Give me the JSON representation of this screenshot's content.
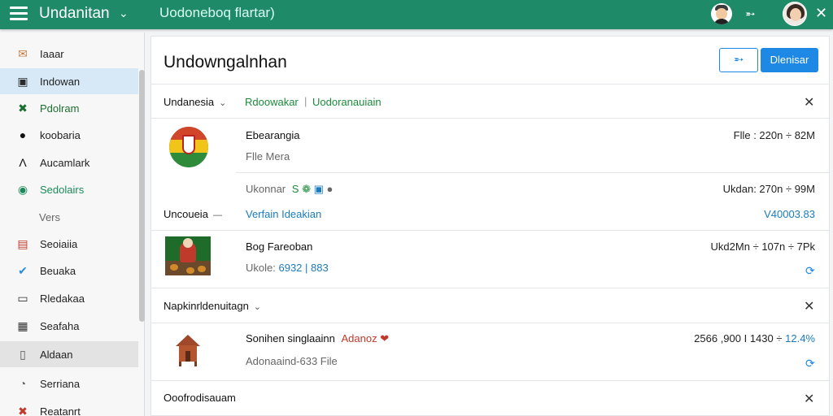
{
  "header": {
    "title": "Undanitan",
    "subtitle": "Uodoneboq flartar)",
    "menu_icon": "hamburger-icon",
    "chevron_icon": "chevron-down-icon",
    "pin_icon": "pin-icon",
    "close_icon": "close-icon",
    "accent": "#1f8a68"
  },
  "sidebar": {
    "items": [
      {
        "label": "Iaaar",
        "icon": "mail-icon",
        "color": "#c87a3a"
      },
      {
        "label": "Indowan",
        "icon": "inbox-icon",
        "color": "#2b2b2b"
      },
      {
        "label": "Pdolram",
        "icon": "tools-icon",
        "color": "#1b6f2e"
      },
      {
        "label": "koobaria",
        "icon": "circle-icon",
        "color": "#111111"
      },
      {
        "label": "Aucamlark",
        "icon": "triangle-icon",
        "color": "#111111"
      },
      {
        "label": "Sedolairs",
        "icon": "toggle-icon",
        "color": "#1b8a5a"
      },
      {
        "label": "Vers",
        "icon": "",
        "color": ""
      },
      {
        "label": "Seoiaiia",
        "icon": "card-icon",
        "color": "#c0392b"
      },
      {
        "label": "Beuaka",
        "icon": "check-circle-icon",
        "color": "#2a8fd6"
      },
      {
        "label": "Rledakaa",
        "icon": "document-icon",
        "color": "#333333"
      },
      {
        "label": "Seafaha",
        "icon": "grid-icon",
        "color": "#333333"
      },
      {
        "label": "Aldaan",
        "icon": "bookmark-icon",
        "color": "#555555"
      },
      {
        "label": "Serriana",
        "icon": "clock-icon",
        "color": "#666666"
      },
      {
        "label": "Reatanrt",
        "icon": "tools-icon",
        "color": "#c0392b"
      }
    ]
  },
  "main": {
    "title": "Undowngalnhan",
    "primary_button": "Dlenisar",
    "icon_button": "pin-icon",
    "sections": [
      {
        "title": "Undanesia",
        "links": [
          "Rdoowakar",
          "Uodoranauiain"
        ]
      },
      {
        "title": "Uncoueia",
        "link": "Verfain Ideakian",
        "right": "V40003.83"
      },
      {
        "title": "Napkinrldenuitagn"
      },
      {
        "title": "Ooofrodisauam"
      }
    ],
    "items": [
      {
        "title": "Ebearangia",
        "subtitle": "Flle Mera",
        "right": "Flle : 220n ÷ 82M",
        "detail_left": "Ukonnar",
        "detail_right": "Ukdan: 270n ÷ 99M"
      },
      {
        "title": "Bog Fareoban",
        "subtitle_prefix": "Ukole:",
        "subtitle_value": "6932  |  883",
        "right": "Ukd2Mn ÷ 107n ÷ 7Pk"
      },
      {
        "title": "Sonihen singlaainn",
        "badge": "Adanoz",
        "subtitle": "Adonaaind-633 File",
        "right_prefix": "2566 ,900 I 1430 ÷",
        "right_value": "12.4%"
      }
    ]
  }
}
